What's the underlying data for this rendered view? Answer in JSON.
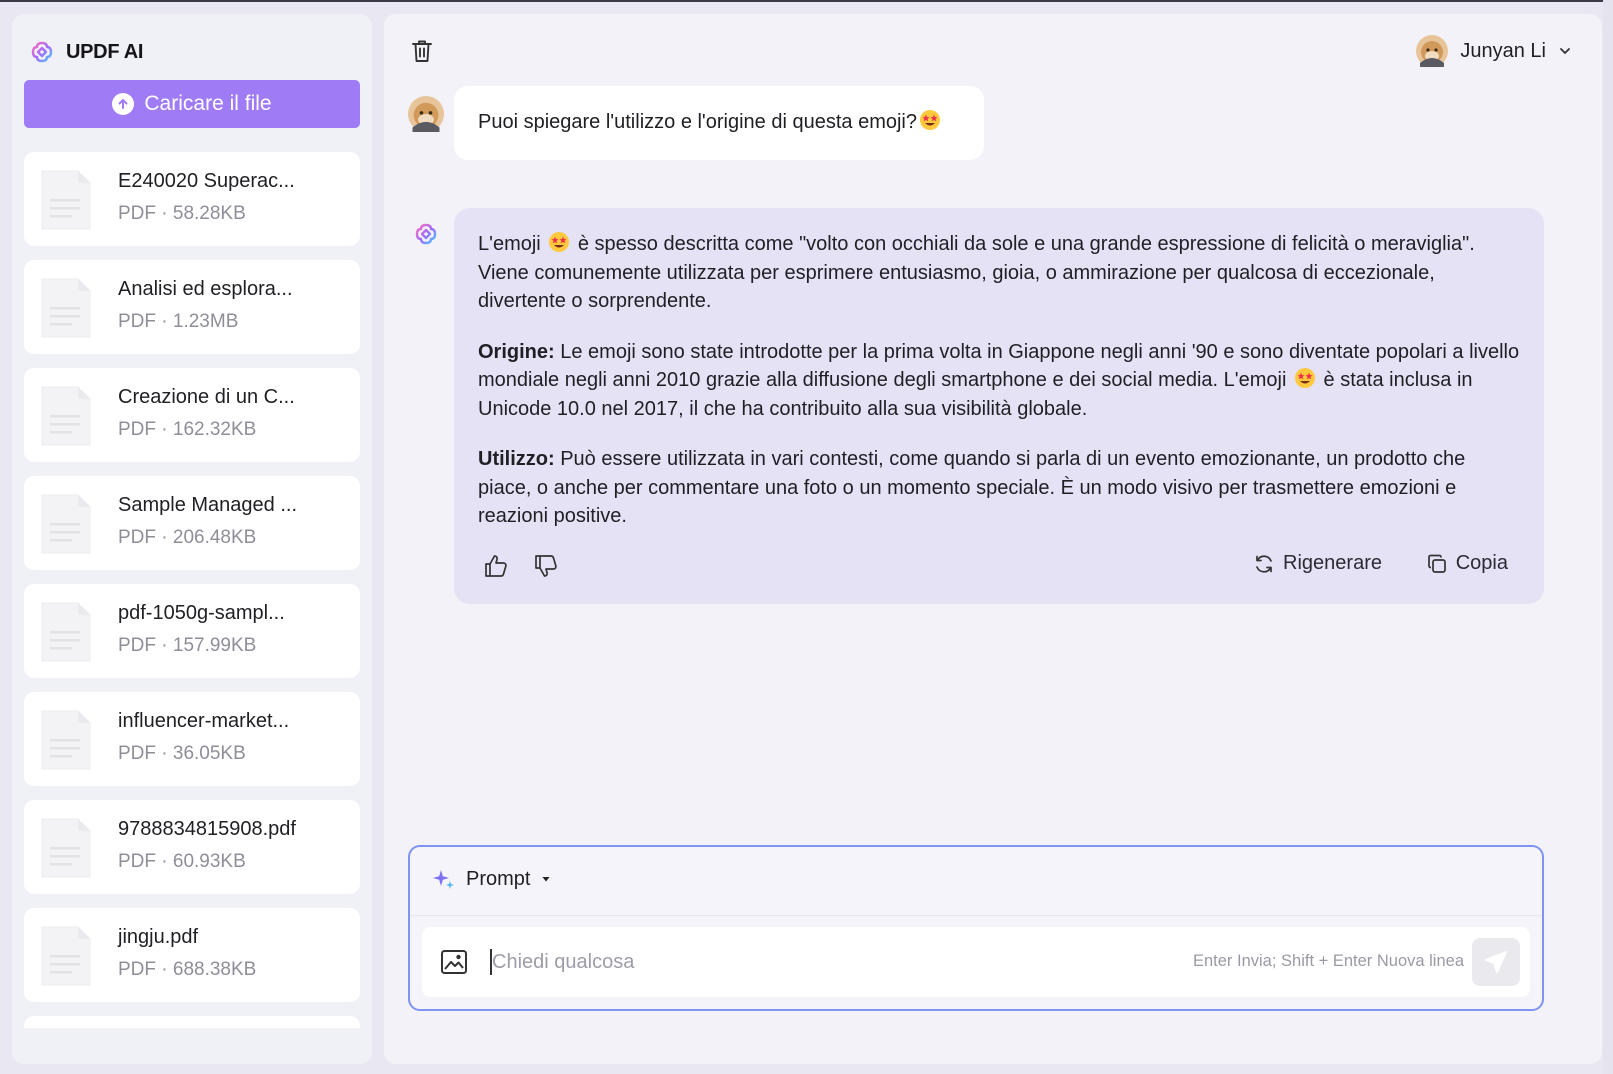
{
  "app": {
    "name": "UPDF AI"
  },
  "sidebar": {
    "upload_label": "Caricare il file",
    "files": [
      {
        "name": "E240020 Superac...",
        "meta": "PDF · 58.28KB"
      },
      {
        "name": "Analisi ed esplora...",
        "meta": "PDF · 1.23MB"
      },
      {
        "name": "Creazione di un C...",
        "meta": "PDF · 162.32KB"
      },
      {
        "name": "Sample Managed ...",
        "meta": "PDF · 206.48KB"
      },
      {
        "name": "pdf-1050g-sampl...",
        "meta": "PDF · 157.99KB"
      },
      {
        "name": "influencer-market...",
        "meta": "PDF · 36.05KB"
      },
      {
        "name": "9788834815908.pdf",
        "meta": "PDF · 60.93KB"
      },
      {
        "name": "jingju.pdf",
        "meta": "PDF · 688.38KB"
      }
    ]
  },
  "header": {
    "user_name": "Junyan Li"
  },
  "chat": {
    "question": "Puoi spiegare l'utilizzo e l'origine di questa emoji?",
    "answer": {
      "p1_a": "L'emoji",
      "p1_b": "è spesso descritta come \"volto con occhiali da sole e una grande espressione di felicità o meraviglia\". Viene comunemente utilizzata per esprimere entusiasmo, gioia, o ammirazione per qualcosa di eccezionale, divertente o sorprendente.",
      "p2_label": "Origine:",
      "p2_a": "Le emoji sono state introdotte per la prima volta in Giappone negli anni '90 e sono diventate popolari a livello mondiale negli anni 2010 grazie alla diffusione degli smartphone e dei social media. L'emoji",
      "p2_b": "è stata inclusa in Unicode 10.0 nel 2017, il che ha contribuito alla sua visibilità globale.",
      "p3_label": "Utilizzo:",
      "p3_text": "Può essere utilizzata in vari contesti, come quando si parla di un evento emozionante, un prodotto che piace, o anche per commentare una foto o un momento speciale. È un modo visivo per trasmettere emozioni e reazioni positive."
    },
    "actions": {
      "regenerate": "Rigenerare",
      "copy": "Copia"
    }
  },
  "input": {
    "prompt_label": "Prompt",
    "placeholder": "Chiedi qualcosa",
    "hint": "Enter Invia; Shift + Enter Nuova linea"
  },
  "colors": {
    "accent": "#9f7bf5",
    "input_border": "#7f93f0",
    "answer_bg": "#e5e2f6"
  },
  "icons": [
    "updf-logo-icon",
    "upload-icon",
    "pdf-file-icon",
    "trash-icon",
    "avatar",
    "chevron-down-icon",
    "star-struck-emoji",
    "thumbs-up-icon",
    "thumbs-down-icon",
    "regenerate-icon",
    "copy-icon",
    "sparkle-icon",
    "caret-down-icon",
    "image-icon",
    "send-icon"
  ]
}
